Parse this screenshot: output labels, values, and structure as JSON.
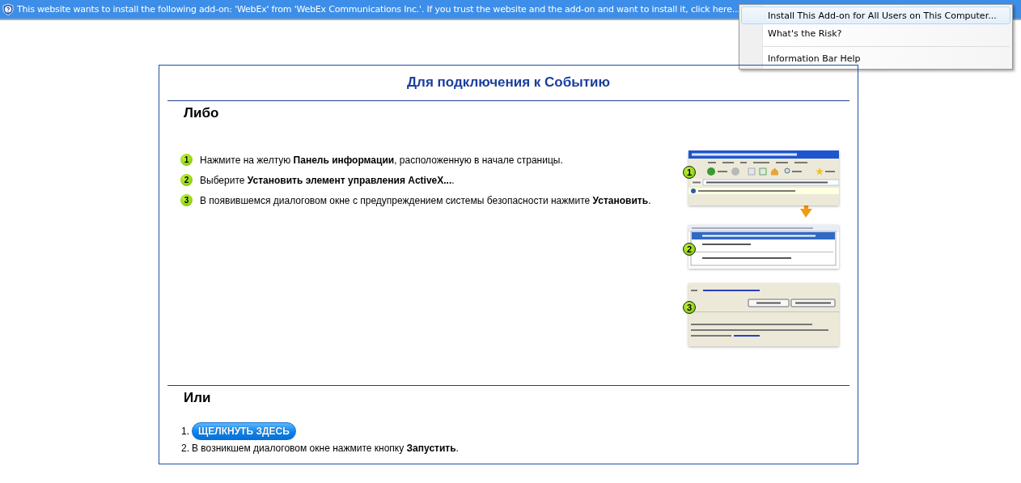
{
  "info_bar": {
    "text": "This website wants to install the following add-on: 'WebEx' from 'WebEx Communications Inc.'. If you trust the website and the add-on and want to install it, click here..."
  },
  "menu": {
    "items": [
      {
        "label": "Install This Add-on for All Users on This Computer...",
        "selected": true,
        "divider_above": false
      },
      {
        "label": "What's the Risk?",
        "selected": false,
        "divider_above": false
      },
      {
        "label": "Information Bar Help",
        "selected": false,
        "divider_above": true
      }
    ]
  },
  "page": {
    "title": "Для подключения к Событию",
    "section_1": {
      "heading": "Либо",
      "steps": [
        {
          "number": "1",
          "text": "Нажмите на желтую **Панель информации**, расположенную в начале страницы."
        },
        {
          "number": "2",
          "text": "Выберите **Установить элемент управления ActiveX...**."
        },
        {
          "number": "3",
          "text": "В появившемся диалоговом окне с предупреждением системы безопасности нажмите **Установить**."
        }
      ]
    },
    "illustration": {
      "panels": [
        {
          "kind": "browser",
          "badge": "1"
        },
        {
          "kind": "menu",
          "badge": "2"
        },
        {
          "kind": "dialog",
          "badge": "3"
        }
      ]
    },
    "section_2": {
      "heading": "Или",
      "items": [
        {
          "number": "1.",
          "kind": "button",
          "label": "ЩЕЛКНУТЬ ЗДЕСЬ"
        },
        {
          "number": "2.",
          "kind": "text",
          "text": "В возникшем диалоговом окне нажмите кнопку **Запустить**."
        }
      ]
    }
  }
}
